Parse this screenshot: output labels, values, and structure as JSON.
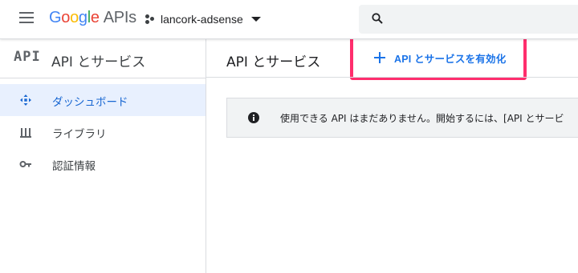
{
  "header": {
    "logo": {
      "letters": [
        "G",
        "o",
        "o",
        "g",
        "l",
        "e"
      ],
      "suffix": "APIs"
    },
    "project": {
      "name": "lancork-adsense"
    },
    "search": {
      "icon": "search-icon"
    }
  },
  "sidebar": {
    "title_badge": "API",
    "title": "API とサービス",
    "items": [
      {
        "label": "ダッシュボード",
        "icon": "dashboard-icon",
        "active": true
      },
      {
        "label": "ライブラリ",
        "icon": "library-icon",
        "active": false
      },
      {
        "label": "認証情報",
        "icon": "key-icon",
        "active": false
      }
    ]
  },
  "main": {
    "title": "API とサービス",
    "enable_button": {
      "label": "API とサービスを有効化",
      "icon": "plus-icon"
    },
    "info_banner": {
      "icon": "info-icon",
      "text": "使用できる API はまだありません。開始するには、[API とサービ"
    }
  },
  "colors": {
    "accent": "#1a73e8",
    "active_bg": "#e8f0fe",
    "highlight": "#ff2e6d",
    "banner_bg": "#f1f3f4"
  }
}
